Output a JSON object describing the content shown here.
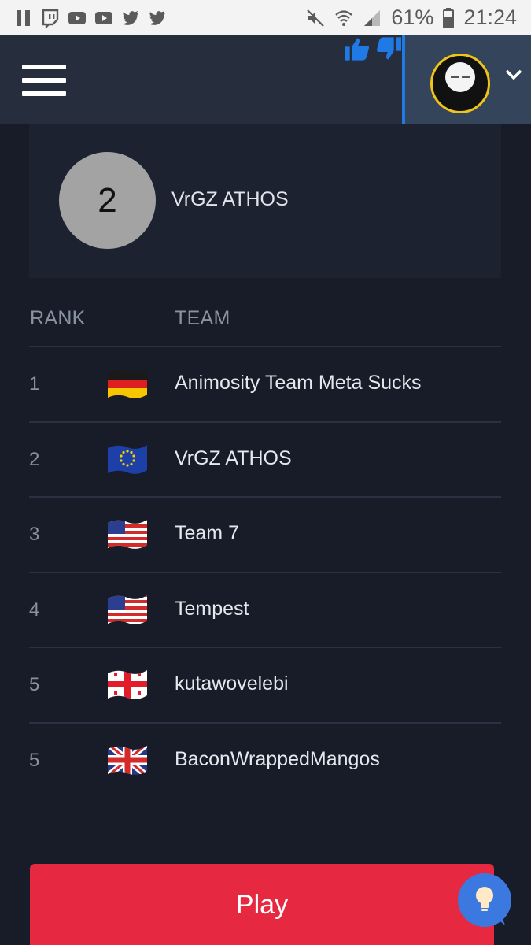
{
  "status_bar": {
    "battery": "61%",
    "time": "21:24"
  },
  "selected_team": {
    "rank": "2",
    "name": "VrGZ ATHOS"
  },
  "table": {
    "headers": {
      "rank": "RANK",
      "team": "TEAM"
    },
    "rows": [
      {
        "rank": "1",
        "flag": "germany-flag-icon",
        "team": "Animosity Team Meta Sucks"
      },
      {
        "rank": "2",
        "flag": "eu-flag-icon",
        "team": "VrGZ ATHOS"
      },
      {
        "rank": "3",
        "flag": "usa-flag-icon",
        "team": "Team 7"
      },
      {
        "rank": "4",
        "flag": "usa-flag-icon",
        "team": "Tempest"
      },
      {
        "rank": "5",
        "flag": "georgia-flag-icon",
        "team": "kutawovelebi"
      },
      {
        "rank": "5",
        "flag": "uk-flag-icon",
        "team": "BaconWrappedMangos"
      }
    ]
  },
  "play_button": {
    "label": "Play"
  },
  "colors": {
    "background": "#171c28",
    "header": "#262e3e",
    "accent_blue": "#1f7ae6",
    "play_red": "#e62841"
  }
}
